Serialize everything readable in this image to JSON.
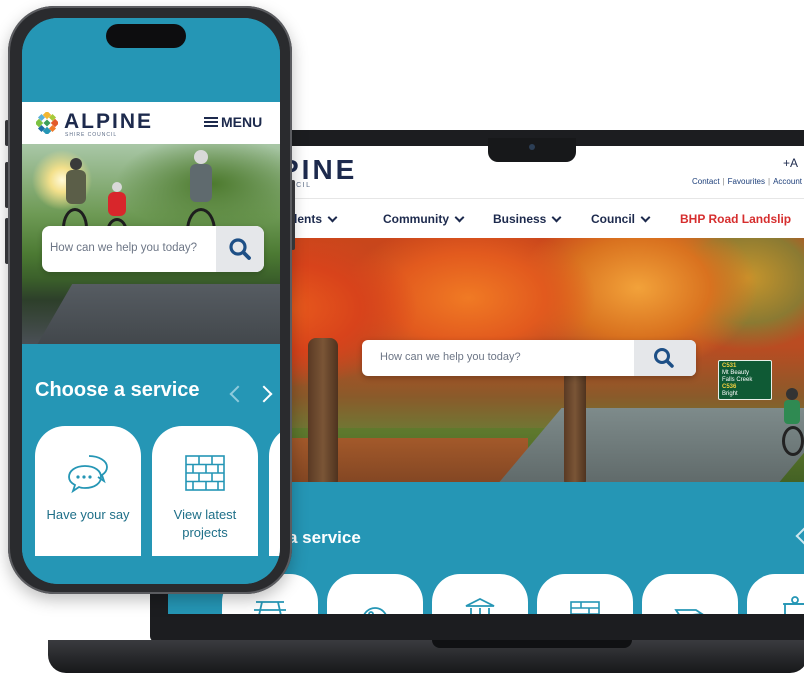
{
  "colors": {
    "brand_teal": "#2596b5",
    "navy": "#1d2a4d",
    "alert_red": "#d62e2e",
    "card_text": "#1e6f88"
  },
  "laptop": {
    "logo_text": "PINE",
    "logo_sub": "UNCIL",
    "font_size_control": "+A",
    "utility_links": [
      "Contact",
      "Favourites",
      "Account"
    ],
    "nav": [
      {
        "label": "sidents",
        "has_dropdown": true
      },
      {
        "label": "Community",
        "has_dropdown": true
      },
      {
        "label": "Business",
        "has_dropdown": true
      },
      {
        "label": "Council",
        "has_dropdown": true
      },
      {
        "label": "BHP Road Landslip",
        "has_dropdown": false
      }
    ],
    "search": {
      "placeholder": "How can we help you today?",
      "icon": "search-icon"
    },
    "road_sign": {
      "line1": "C531",
      "line2": "Mt Beauty",
      "line3": "Falls Creek",
      "line4": "C536",
      "line5": "Bright"
    },
    "services_title": "a service",
    "service_card_icons": [
      "picnic-table-icon",
      "dome-icon",
      "bank-building-icon",
      "brick-wall-icon",
      "hand-icon",
      "recycle-bin-icon"
    ]
  },
  "phone": {
    "logo_text": "ALPINE",
    "logo_sub": "SHIRE COUNCIL",
    "menu_label": "MENU",
    "search": {
      "placeholder": "How can we help you today?",
      "icon": "search-icon"
    },
    "services_title": "Choose a service",
    "cards": [
      {
        "label": "Have your say",
        "icon": "speech-bubbles-icon"
      },
      {
        "label": "View latest projects",
        "icon": "brick-wall-icon"
      }
    ]
  }
}
